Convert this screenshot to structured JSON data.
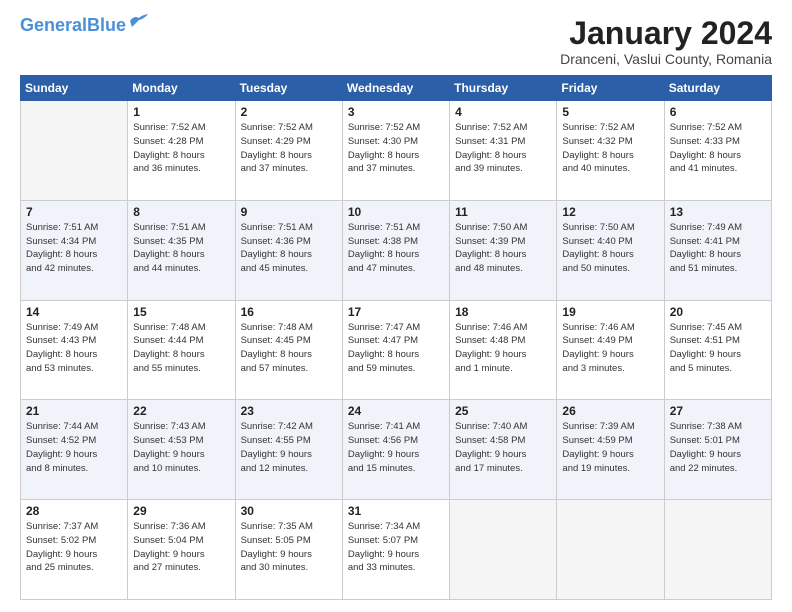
{
  "header": {
    "logo_line1": "General",
    "logo_line2": "Blue",
    "month_title": "January 2024",
    "location": "Dranceni, Vaslui County, Romania"
  },
  "days_of_week": [
    "Sunday",
    "Monday",
    "Tuesday",
    "Wednesday",
    "Thursday",
    "Friday",
    "Saturday"
  ],
  "weeks": [
    [
      {
        "num": "",
        "text": ""
      },
      {
        "num": "1",
        "text": "Sunrise: 7:52 AM\nSunset: 4:28 PM\nDaylight: 8 hours\nand 36 minutes."
      },
      {
        "num": "2",
        "text": "Sunrise: 7:52 AM\nSunset: 4:29 PM\nDaylight: 8 hours\nand 37 minutes."
      },
      {
        "num": "3",
        "text": "Sunrise: 7:52 AM\nSunset: 4:30 PM\nDaylight: 8 hours\nand 37 minutes."
      },
      {
        "num": "4",
        "text": "Sunrise: 7:52 AM\nSunset: 4:31 PM\nDaylight: 8 hours\nand 39 minutes."
      },
      {
        "num": "5",
        "text": "Sunrise: 7:52 AM\nSunset: 4:32 PM\nDaylight: 8 hours\nand 40 minutes."
      },
      {
        "num": "6",
        "text": "Sunrise: 7:52 AM\nSunset: 4:33 PM\nDaylight: 8 hours\nand 41 minutes."
      }
    ],
    [
      {
        "num": "7",
        "text": "Sunrise: 7:51 AM\nSunset: 4:34 PM\nDaylight: 8 hours\nand 42 minutes."
      },
      {
        "num": "8",
        "text": "Sunrise: 7:51 AM\nSunset: 4:35 PM\nDaylight: 8 hours\nand 44 minutes."
      },
      {
        "num": "9",
        "text": "Sunrise: 7:51 AM\nSunset: 4:36 PM\nDaylight: 8 hours\nand 45 minutes."
      },
      {
        "num": "10",
        "text": "Sunrise: 7:51 AM\nSunset: 4:38 PM\nDaylight: 8 hours\nand 47 minutes."
      },
      {
        "num": "11",
        "text": "Sunrise: 7:50 AM\nSunset: 4:39 PM\nDaylight: 8 hours\nand 48 minutes."
      },
      {
        "num": "12",
        "text": "Sunrise: 7:50 AM\nSunset: 4:40 PM\nDaylight: 8 hours\nand 50 minutes."
      },
      {
        "num": "13",
        "text": "Sunrise: 7:49 AM\nSunset: 4:41 PM\nDaylight: 8 hours\nand 51 minutes."
      }
    ],
    [
      {
        "num": "14",
        "text": "Sunrise: 7:49 AM\nSunset: 4:43 PM\nDaylight: 8 hours\nand 53 minutes."
      },
      {
        "num": "15",
        "text": "Sunrise: 7:48 AM\nSunset: 4:44 PM\nDaylight: 8 hours\nand 55 minutes."
      },
      {
        "num": "16",
        "text": "Sunrise: 7:48 AM\nSunset: 4:45 PM\nDaylight: 8 hours\nand 57 minutes."
      },
      {
        "num": "17",
        "text": "Sunrise: 7:47 AM\nSunset: 4:47 PM\nDaylight: 8 hours\nand 59 minutes."
      },
      {
        "num": "18",
        "text": "Sunrise: 7:46 AM\nSunset: 4:48 PM\nDaylight: 9 hours\nand 1 minute."
      },
      {
        "num": "19",
        "text": "Sunrise: 7:46 AM\nSunset: 4:49 PM\nDaylight: 9 hours\nand 3 minutes."
      },
      {
        "num": "20",
        "text": "Sunrise: 7:45 AM\nSunset: 4:51 PM\nDaylight: 9 hours\nand 5 minutes."
      }
    ],
    [
      {
        "num": "21",
        "text": "Sunrise: 7:44 AM\nSunset: 4:52 PM\nDaylight: 9 hours\nand 8 minutes."
      },
      {
        "num": "22",
        "text": "Sunrise: 7:43 AM\nSunset: 4:53 PM\nDaylight: 9 hours\nand 10 minutes."
      },
      {
        "num": "23",
        "text": "Sunrise: 7:42 AM\nSunset: 4:55 PM\nDaylight: 9 hours\nand 12 minutes."
      },
      {
        "num": "24",
        "text": "Sunrise: 7:41 AM\nSunset: 4:56 PM\nDaylight: 9 hours\nand 15 minutes."
      },
      {
        "num": "25",
        "text": "Sunrise: 7:40 AM\nSunset: 4:58 PM\nDaylight: 9 hours\nand 17 minutes."
      },
      {
        "num": "26",
        "text": "Sunrise: 7:39 AM\nSunset: 4:59 PM\nDaylight: 9 hours\nand 19 minutes."
      },
      {
        "num": "27",
        "text": "Sunrise: 7:38 AM\nSunset: 5:01 PM\nDaylight: 9 hours\nand 22 minutes."
      }
    ],
    [
      {
        "num": "28",
        "text": "Sunrise: 7:37 AM\nSunset: 5:02 PM\nDaylight: 9 hours\nand 25 minutes."
      },
      {
        "num": "29",
        "text": "Sunrise: 7:36 AM\nSunset: 5:04 PM\nDaylight: 9 hours\nand 27 minutes."
      },
      {
        "num": "30",
        "text": "Sunrise: 7:35 AM\nSunset: 5:05 PM\nDaylight: 9 hours\nand 30 minutes."
      },
      {
        "num": "31",
        "text": "Sunrise: 7:34 AM\nSunset: 5:07 PM\nDaylight: 9 hours\nand 33 minutes."
      },
      {
        "num": "",
        "text": ""
      },
      {
        "num": "",
        "text": ""
      },
      {
        "num": "",
        "text": ""
      }
    ]
  ]
}
